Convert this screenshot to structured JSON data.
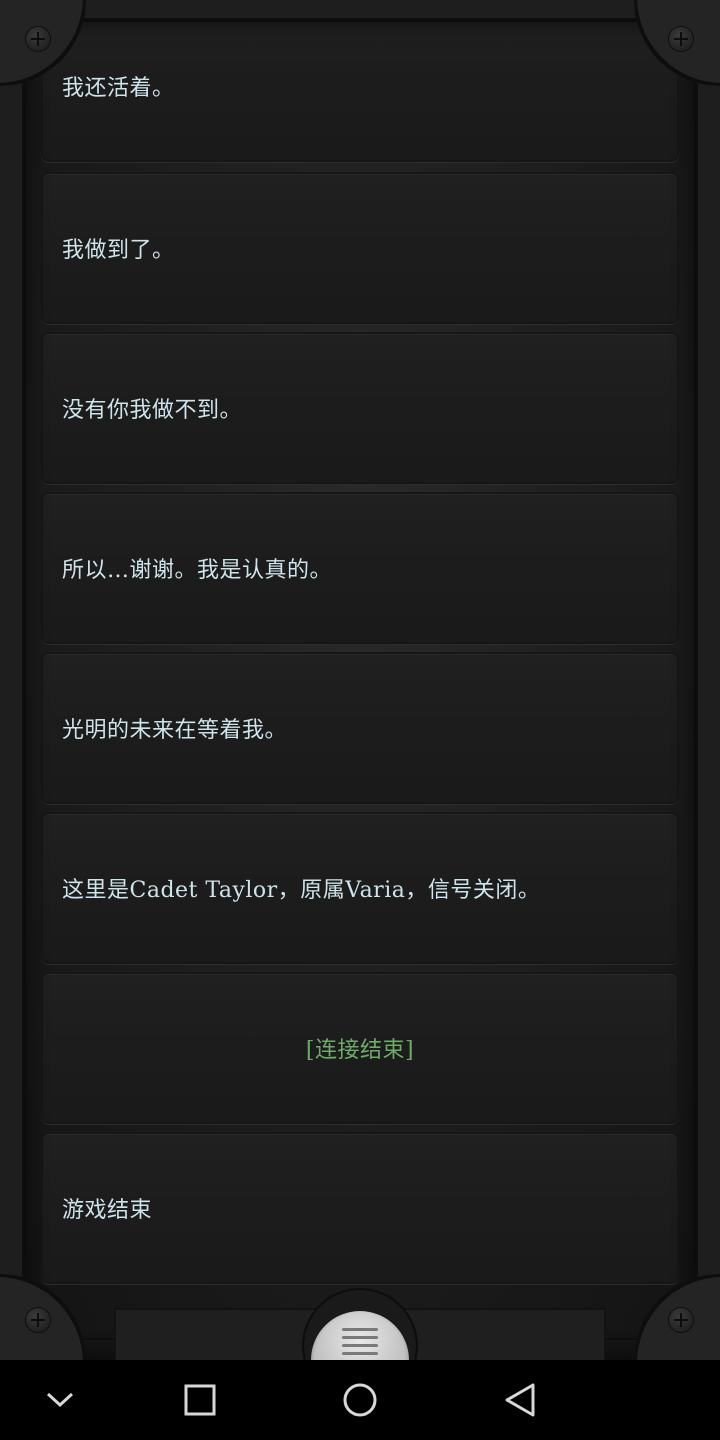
{
  "messages": [
    {
      "text": "我还活着。",
      "kind": "normal"
    },
    {
      "text": "我做到了。",
      "kind": "normal"
    },
    {
      "text": "没有你我做不到。",
      "kind": "normal"
    },
    {
      "text": "所以…谢谢。我是认真的。",
      "kind": "normal"
    },
    {
      "text": "光明的未来在等着我。",
      "kind": "normal"
    },
    {
      "text": "这里是Cadet Taylor，原属Varia，信号关闭。",
      "kind": "normal"
    },
    {
      "text": "[连接结束]",
      "kind": "system"
    },
    {
      "text": "游戏结束",
      "kind": "normal"
    }
  ],
  "menu_button": {
    "icon": "menu-lines-icon"
  },
  "nav_bar": {
    "buttons": [
      {
        "name": "hide-nav-button",
        "icon": "chevron-down-icon"
      },
      {
        "name": "recent-apps-button",
        "icon": "square-icon"
      },
      {
        "name": "home-button",
        "icon": "circle-icon"
      },
      {
        "name": "back-button",
        "icon": "triangle-back-icon"
      }
    ]
  },
  "colors": {
    "message_text": "#cfe3ea",
    "system_text": "#6dab68",
    "background": "#1b1b1b"
  }
}
